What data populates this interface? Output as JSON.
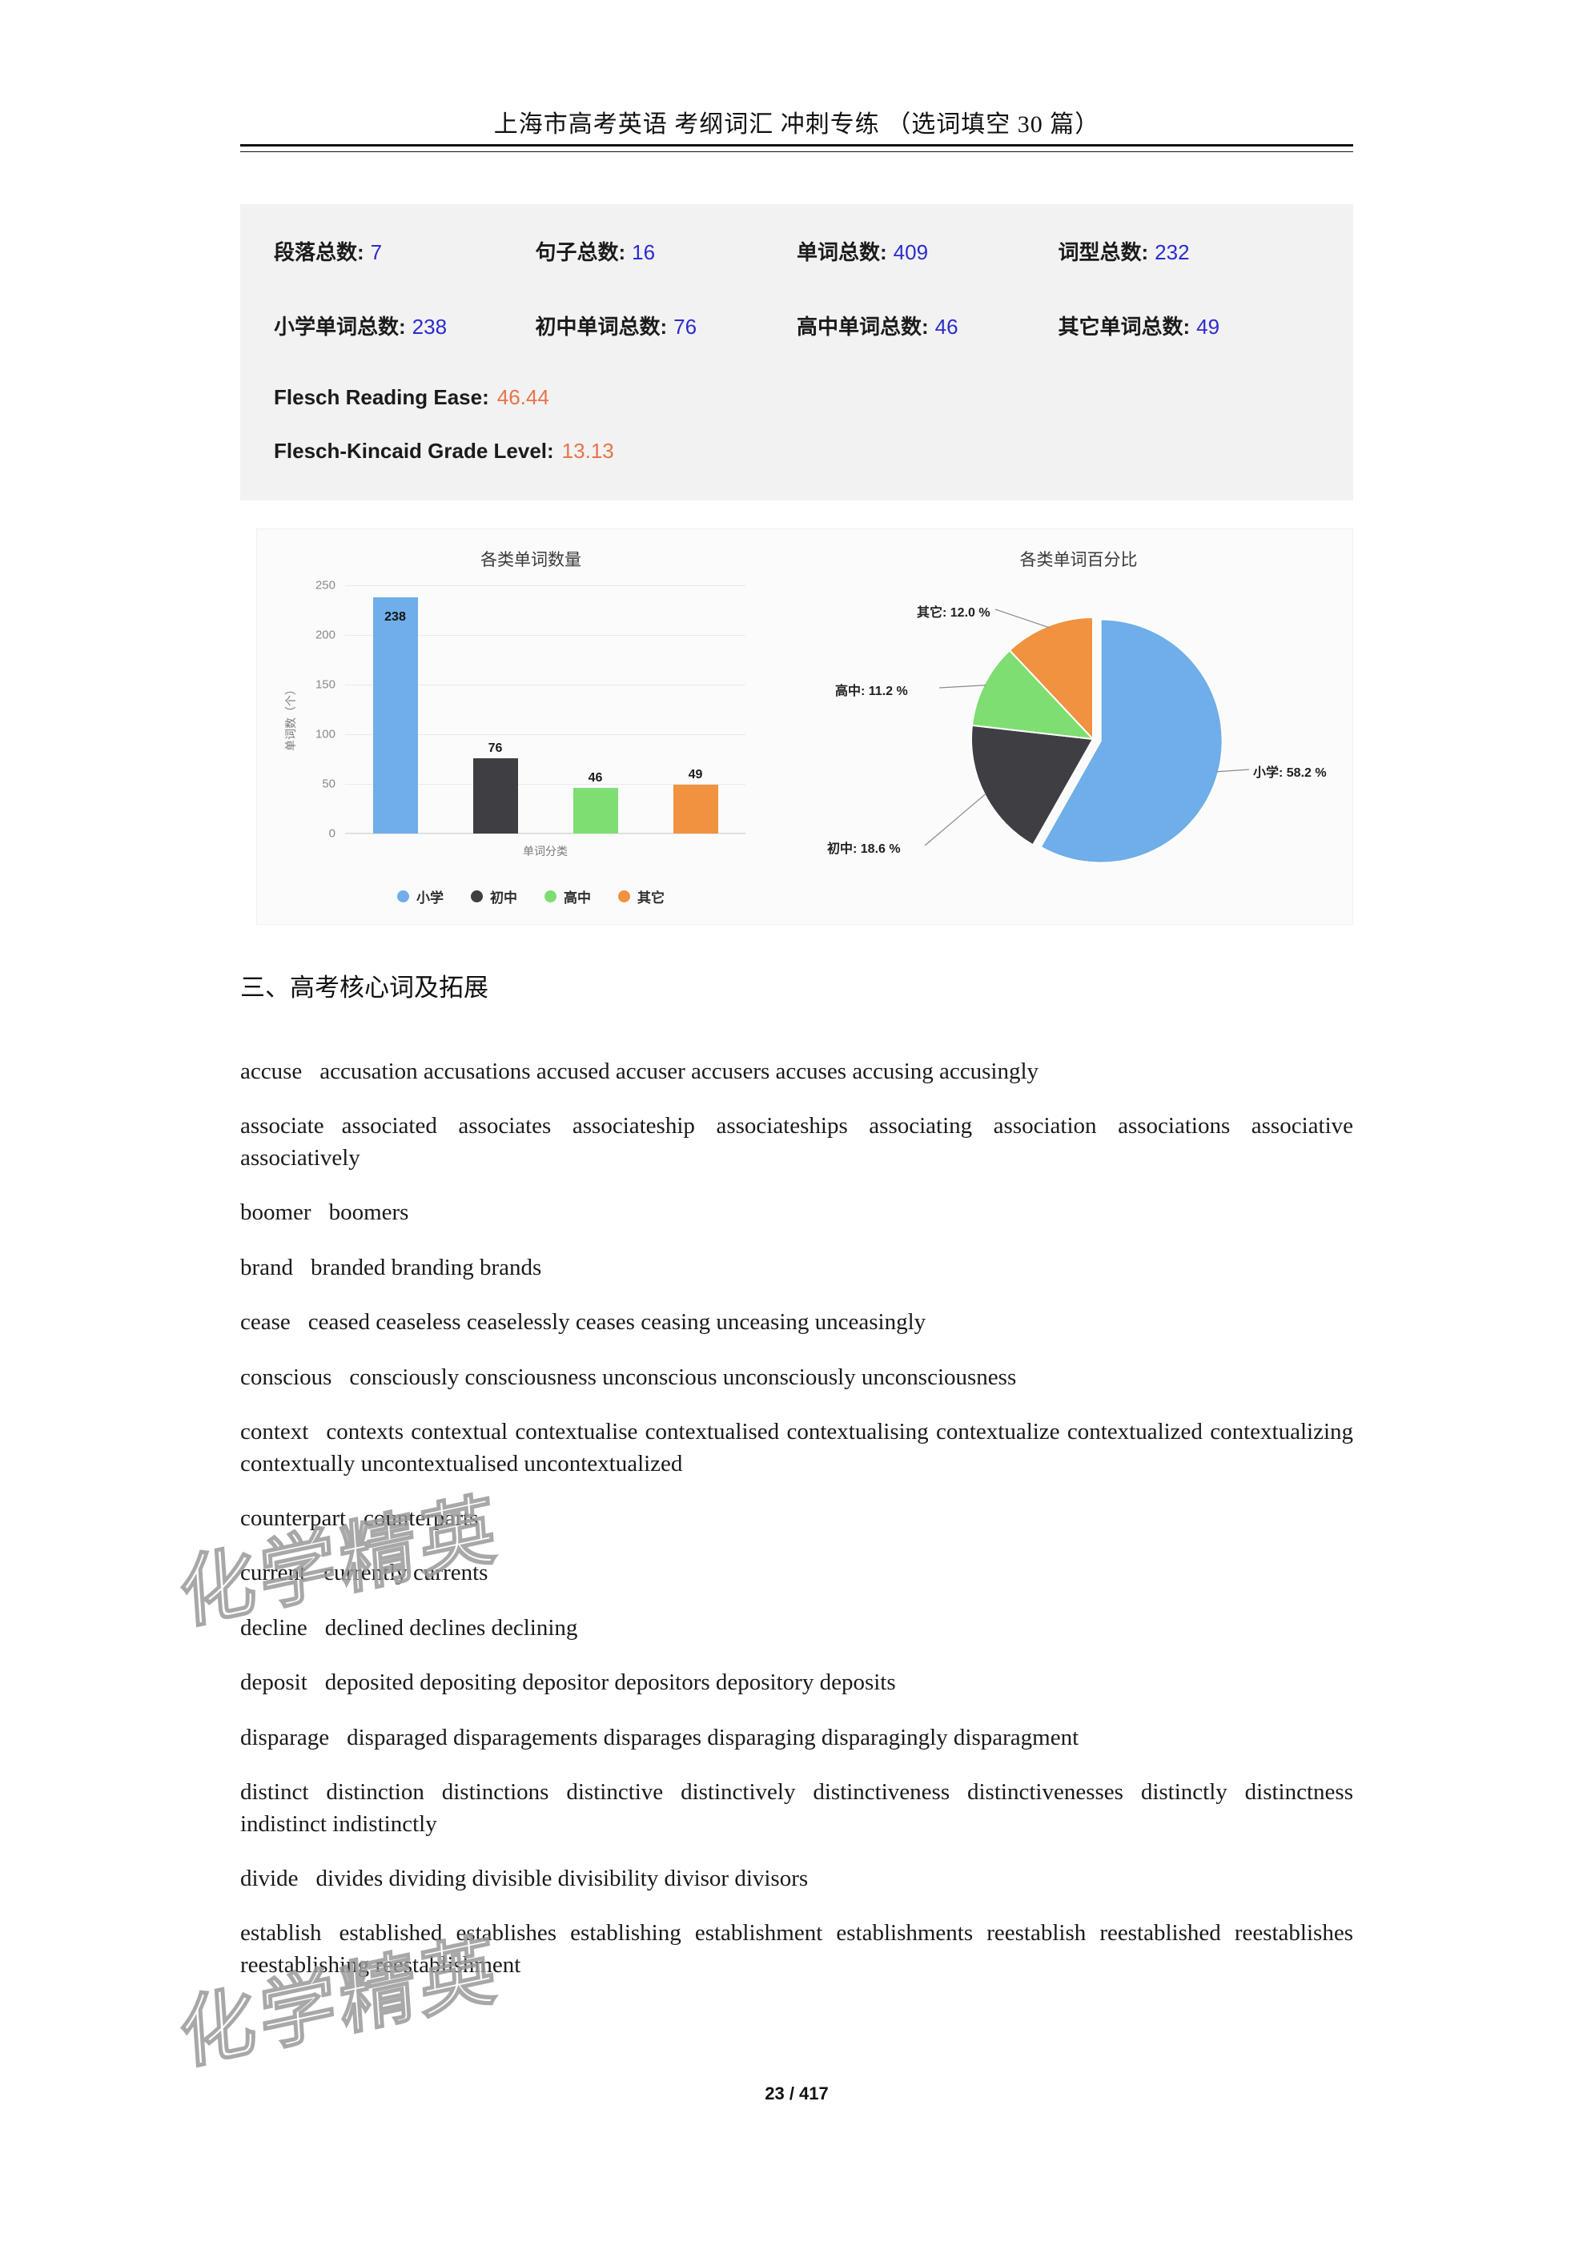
{
  "header": {
    "title": "上海市高考英语 考纲词汇 冲刺专练 （选词填空 30 篇）"
  },
  "stats": {
    "row1": [
      {
        "label": "段落总数:",
        "value": "7"
      },
      {
        "label": "句子总数:",
        "value": "16"
      },
      {
        "label": "单词总数:",
        "value": "409"
      },
      {
        "label": "词型总数:",
        "value": "232"
      }
    ],
    "row2": [
      {
        "label": "小学单词总数:",
        "value": "238"
      },
      {
        "label": "初中单词总数:",
        "value": "76"
      },
      {
        "label": "高中单词总数:",
        "value": "46"
      },
      {
        "label": "其它单词总数:",
        "value": "49"
      }
    ],
    "flesch_reading_ease": {
      "label": "Flesch Reading Ease:",
      "value": "46.44"
    },
    "flesch_kincaid_grade": {
      "label": "Flesch-Kincaid Grade Level:",
      "value": "13.13"
    },
    "value_color": "#2b2bd0",
    "flesch_color": "#e8734a",
    "panel_background": "#f2f2f2"
  },
  "chart_data": [
    {
      "type": "bar",
      "title": "各类单词数量",
      "xlabel": "单词分类",
      "ylabel": "单词数（个）",
      "categories": [
        "小学",
        "初中",
        "高中",
        "其它"
      ],
      "values": [
        238,
        76,
        46,
        49
      ],
      "ylim": [
        0,
        250
      ],
      "yticks": [
        250,
        200,
        150,
        100,
        50,
        0
      ],
      "colors": [
        "#6faee8",
        "#3f3f43",
        "#7ede72",
        "#f0923f"
      ],
      "grid": true,
      "legend_position": "bottom",
      "legend": [
        "小学",
        "初中",
        "高中",
        "其它"
      ]
    },
    {
      "type": "pie",
      "title": "各类单词百分比",
      "categories": [
        "小学",
        "初中",
        "高中",
        "其它"
      ],
      "values": [
        58.2,
        18.6,
        11.2,
        12.0
      ],
      "labels": [
        "小学: 58.2 %",
        "初中: 18.6 %",
        "高中: 11.2 %",
        "其它: 12.0 %"
      ],
      "colors": [
        "#6faee8",
        "#3f3f43",
        "#7ede72",
        "#f0923f"
      ],
      "exploded_slice": "小学",
      "legend_position": "none"
    }
  ],
  "section": {
    "heading": "三、高考核心词及拓展",
    "entries": [
      {
        "headword": "accuse",
        "forms": "accusation accusations accused accuser accusers accuses accusing accusingly"
      },
      {
        "headword": "associate",
        "forms": "associated associates associateship associateships associating association associations associative associatively"
      },
      {
        "headword": "boomer",
        "forms": "boomers"
      },
      {
        "headword": "brand",
        "forms": "branded branding brands"
      },
      {
        "headword": "cease",
        "forms": "ceased ceaseless ceaselessly ceases ceasing unceasing unceasingly"
      },
      {
        "headword": "conscious",
        "forms": "consciously consciousness unconscious unconsciously unconsciousness"
      },
      {
        "headword": "context",
        "forms": "contexts contextual contextualise contextualised contextualising contextualize contextualized contextualizing contextually uncontextualised uncontextualized"
      },
      {
        "headword": "counterpart",
        "forms": "counterparts"
      },
      {
        "headword": "current",
        "forms": "currently currents"
      },
      {
        "headword": "decline",
        "forms": "declined declines declining"
      },
      {
        "headword": "deposit",
        "forms": "deposited depositing depositor depositors depository deposits"
      },
      {
        "headword": "disparage",
        "forms": "disparaged disparagements disparages disparaging disparagingly disparagment"
      },
      {
        "headword": "distinct",
        "forms": "distinction distinctions distinctive distinctively distinctiveness distinctivenesses distinctly distinctness indistinct indistinctly"
      },
      {
        "headword": "divide",
        "forms": "divides dividing divisible divisibility divisor divisors"
      },
      {
        "headword": "establish",
        "forms": "established establishes establishing establishment establishments reestablish reestablished reestablishes reestablishing reestablishment"
      }
    ]
  },
  "watermark": {
    "text": "化学精英"
  },
  "footer": {
    "page": "23 / 417"
  }
}
